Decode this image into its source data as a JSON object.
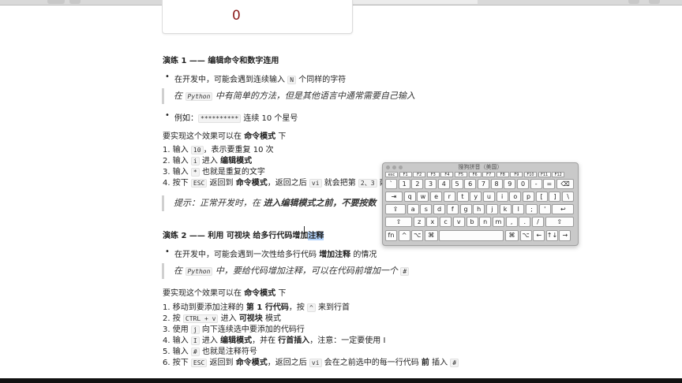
{
  "browser": {
    "url": "file:///Users/lihuima/Documents/python基础/基础文档/编辑器vim.html"
  },
  "output": {
    "value": "0"
  },
  "exercise1": {
    "title": "演练 1 —— 编辑命令和数字连用",
    "bullet1": {
      "pre": "在开发中，可能会遇到连续输入 ",
      "code": "N",
      "post": " 个同样的字符"
    },
    "quote1": {
      "pre": "在 ",
      "code": "Python",
      "post": " 中有简单的方法，但是其他语言中通常需要自己输入"
    },
    "bullet2": {
      "pre": "例如：",
      "code": "**********",
      "post": " 连续 10 个星号"
    },
    "intro": {
      "pre": "要实现这个效果可以在 ",
      "bold": "命令模式",
      "post": " 下"
    },
    "steps": [
      {
        "num": "1.",
        "a": "输入 ",
        "code": "10",
        "b": "，表示要重复 10 次",
        "bold": "",
        "c": ""
      },
      {
        "num": "2.",
        "a": "输入 ",
        "code": "i",
        "b": " 进入 ",
        "bold": "编辑模式",
        "c": ""
      },
      {
        "num": "3.",
        "a": "输入 ",
        "code": "*",
        "b": " 也就是重复的文字",
        "bold": "",
        "c": ""
      },
      {
        "num": "4.",
        "a": "按下 ",
        "code": "ESC",
        "b": " 返回到 ",
        "bold": "命令模式",
        "c": "，返回之后 "
      }
    ],
    "step4_tail": {
      "code1": "vi",
      "mid": " 就会把第 ",
      "code2": "2、3",
      "end": " 两步"
    },
    "tip": {
      "pre": "提示：正常开发时，在 ",
      "bold": "进入编辑模式之前，不要按数"
    }
  },
  "exercise2": {
    "title_pre": "演练 2 —— 利用 可视块 给多行代码增加",
    "title_sel": "注释",
    "bullet1": {
      "pre": "在开发中，可能会遇到一次性给多行代码 ",
      "bold": "增加注释",
      "post": " 的情况"
    },
    "quote": {
      "pre": "在 ",
      "code": "Python",
      "mid": " 中，要给代码增加注释，可以在代码前增加一个 ",
      "code2": "#"
    },
    "intro": {
      "pre": "要实现这个效果可以在 ",
      "bold": "命令模式",
      "post": " 下"
    },
    "s1": {
      "num": "1.",
      "a": "移动到要添加注释的 ",
      "bold": "第 1 行代码",
      "b": "，按 ",
      "code": "^",
      "c": " 来到行首"
    },
    "s2": {
      "num": "2.",
      "a": "按 ",
      "code": "CTRL + v",
      "b": " 进入 ",
      "bold": "可视块",
      "c": " 模式"
    },
    "s3": {
      "num": "3.",
      "a": "使用 ",
      "code": "j",
      "b": " 向下连续选中要添加的代码行"
    },
    "s4": {
      "num": "4.",
      "a": "输入 ",
      "code": "I",
      "b": " 进入 ",
      "bold": "编辑模式",
      "c": "，并在 ",
      "bold2": "行首插入",
      "d": "，注意：一定要使用 I"
    },
    "s5": {
      "num": "5.",
      "a": "输入 ",
      "code": "#",
      "b": " 也就是注释符号"
    },
    "s6": {
      "num": "6.",
      "a": "按下 ",
      "code": "ESC",
      "b": " 返回到 ",
      "bold": "命令模式",
      "c": "，返回之后 ",
      "code2": "vi",
      "d": " 会在之前选中的每一行代码 ",
      "bold2": "前",
      "e": " 插入 ",
      "code3": "#"
    }
  },
  "keyboard": {
    "title": "搜狗拼音（美国）",
    "fkeys": [
      "esc",
      "F1",
      "F2",
      "F3",
      "F4",
      "F5",
      "F6",
      "F7",
      "F8",
      "F9",
      "F10",
      "F11",
      "F12"
    ],
    "row1": [
      "`",
      "1",
      "2",
      "3",
      "4",
      "5",
      "6",
      "7",
      "8",
      "9",
      "0",
      "-",
      "=",
      "⌫"
    ],
    "row2": [
      "⇥",
      "q",
      "w",
      "e",
      "r",
      "t",
      "y",
      "u",
      "i",
      "o",
      "p",
      "[",
      "]",
      "\\"
    ],
    "row3": [
      "⇪",
      "a",
      "s",
      "d",
      "f",
      "g",
      "h",
      "j",
      "k",
      "l",
      ";",
      "'",
      "↩"
    ],
    "row4": [
      "⇧",
      "z",
      "x",
      "c",
      "v",
      "b",
      "n",
      "m",
      ",",
      ".",
      "/",
      "⇧"
    ],
    "row5": [
      "fn",
      "^",
      "⌥",
      "⌘",
      "",
      "⌘",
      "⌥",
      "←",
      "↑↓",
      "→"
    ]
  }
}
